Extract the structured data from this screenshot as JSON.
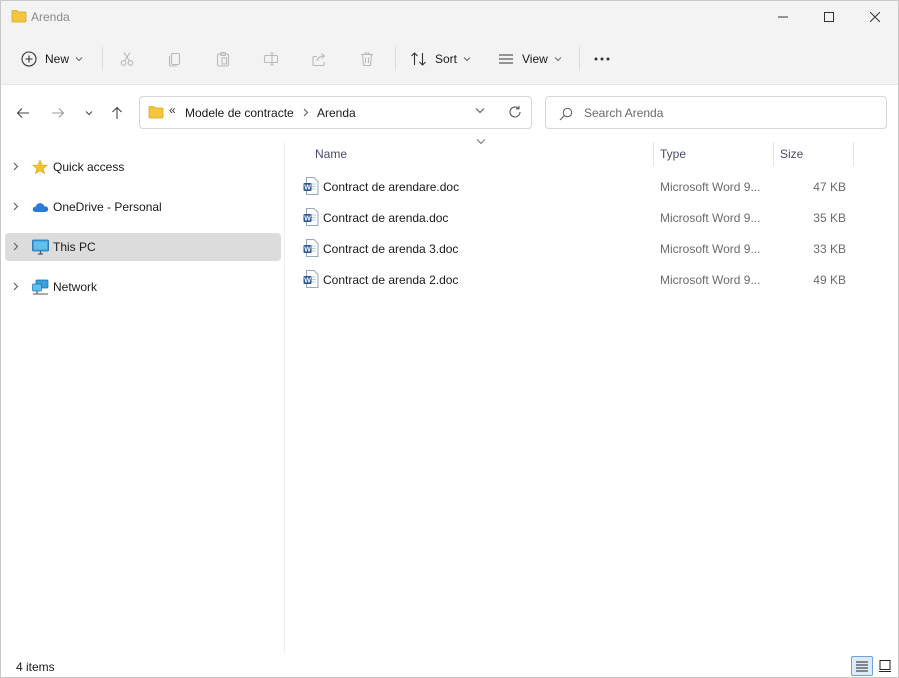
{
  "window": {
    "title": "Arenda",
    "minimize_icon": "minimize-icon",
    "maximize_icon": "maximize-icon",
    "close_icon": "close-icon"
  },
  "toolbar": {
    "new_label": "New",
    "sort_label": "Sort",
    "view_label": "View",
    "icons": [
      "plus-icon",
      "cut-icon",
      "copy-icon",
      "paste-icon",
      "rename-icon",
      "share-icon",
      "delete-icon",
      "sort-icon",
      "view-icon",
      "more-icon"
    ]
  },
  "address": {
    "overflow": "«",
    "crumbs": [
      "Modele de contracte",
      "Arenda"
    ]
  },
  "search": {
    "placeholder": "Search Arenda",
    "value": ""
  },
  "navigation": {
    "items": [
      {
        "label": "Quick access",
        "icon": "star-icon",
        "selected": false
      },
      {
        "label": "OneDrive - Personal",
        "icon": "cloud-icon",
        "selected": false
      },
      {
        "label": "This PC",
        "icon": "monitor-icon",
        "selected": true
      },
      {
        "label": "Network",
        "icon": "network-icon",
        "selected": false
      }
    ]
  },
  "columns": {
    "name": "Name",
    "type": "Type",
    "size": "Size"
  },
  "files": [
    {
      "name": "Contract de arendare.doc",
      "type": "Microsoft Word 9...",
      "size": "47 KB"
    },
    {
      "name": "Contract de arenda.doc",
      "type": "Microsoft Word 9...",
      "size": "35 KB"
    },
    {
      "name": "Contract de arenda 3.doc",
      "type": "Microsoft Word 9...",
      "size": "33 KB"
    },
    {
      "name": "Contract de arenda 2.doc",
      "type": "Microsoft Word 9...",
      "size": "49 KB"
    }
  ],
  "status": {
    "item_count": "4 items"
  },
  "colors": {
    "folder": "#f4c542",
    "accent": "#2b6fb6",
    "selected_nav": "#dcdcdc",
    "chrome": "#f3f3f3"
  }
}
